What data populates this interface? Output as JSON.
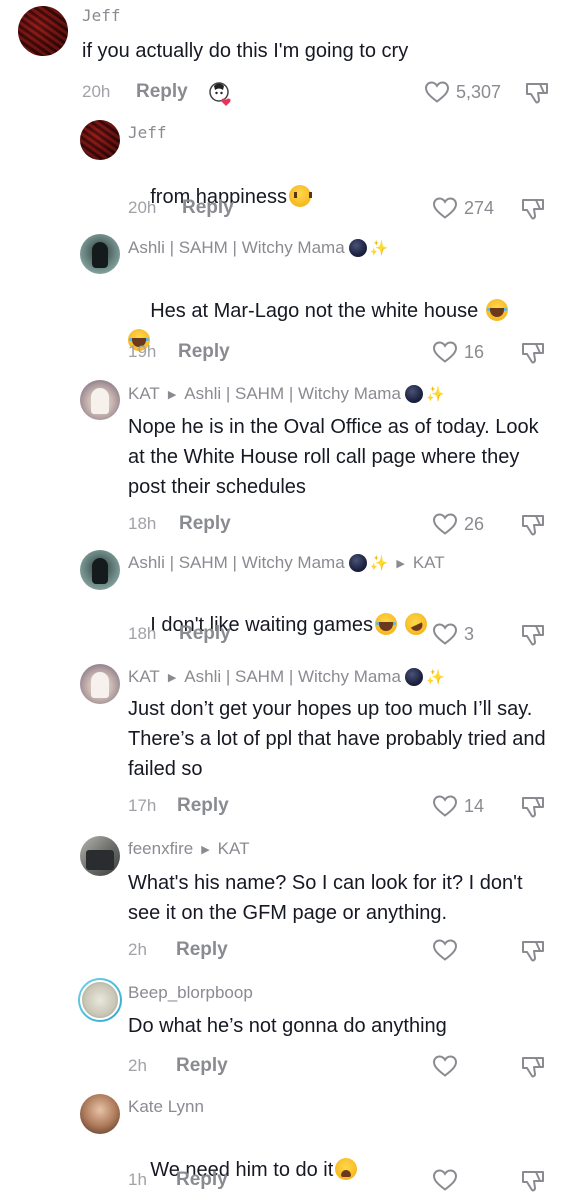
{
  "icons": {
    "like": "heart-outline-icon",
    "dislike": "thumbs-down-icon",
    "reply_arrow": "triangle-right-icon",
    "moon": "dark-moon-emoji-icon",
    "sparkle": "sparkles-emoji-icon",
    "sticker": "avatar-sticker-with-heart-icon"
  },
  "colors": {
    "text": "#161823",
    "muted": "#8a8b91",
    "timestamp": "#a1a2a7"
  },
  "comments": [
    {
      "user": "Jeff",
      "text": "if you actually do this I'm going to cry",
      "time": "20h",
      "reply": "Reply",
      "likes": "5,307"
    },
    {
      "user": "Jeff",
      "text": "from happiness",
      "emoji": [
        "pleading-face"
      ],
      "time": "20h",
      "reply": "Reply",
      "likes": "274"
    },
    {
      "user": "Ashli | SAHM | Witchy Mama",
      "text": "Hes at Mar-Lago not the white house",
      "emoji": [
        "loudly-crying-face",
        "loudly-crying-face"
      ],
      "time": "19h",
      "reply": "Reply",
      "likes": "16"
    },
    {
      "user": "KAT",
      "reply_to": "Ashli | SAHM | Witchy Mama",
      "text": "Nope he is in the Oval Office as of today. Look at the White House roll call page where they post their schedules",
      "time": "18h",
      "reply": "Reply",
      "likes": "26"
    },
    {
      "user": "Ashli | SAHM | Witchy Mama",
      "reply_to": "KAT",
      "text": "I don't like waiting games",
      "emoji": [
        "loudly-crying-face",
        "rolling-on-the-floor-laughing"
      ],
      "time": "18h",
      "reply": "Reply",
      "likes": "3"
    },
    {
      "user": "KAT",
      "reply_to": "Ashli | SAHM | Witchy Mama",
      "text": "Just don’t get your hopes up too much I’ll say. There’s a lot of ppl that have probably tried and failed so",
      "time": "17h",
      "reply": "Reply",
      "likes": "14"
    },
    {
      "user": "feenxfire",
      "reply_to": "KAT",
      "text": "What's his name? So I can look for it? I don't see it on the GFM page or anything.",
      "time": "2h",
      "reply": "Reply",
      "likes": ""
    },
    {
      "user": "Beep_blorpboop",
      "text": "Do what he’s not gonna do anything",
      "time": "2h",
      "reply": "Reply",
      "likes": ""
    },
    {
      "user": "Kate Lynn",
      "text": "We need him to do it",
      "emoji": [
        "weary-face"
      ],
      "time": "1h",
      "reply": "Reply",
      "likes": ""
    }
  ]
}
